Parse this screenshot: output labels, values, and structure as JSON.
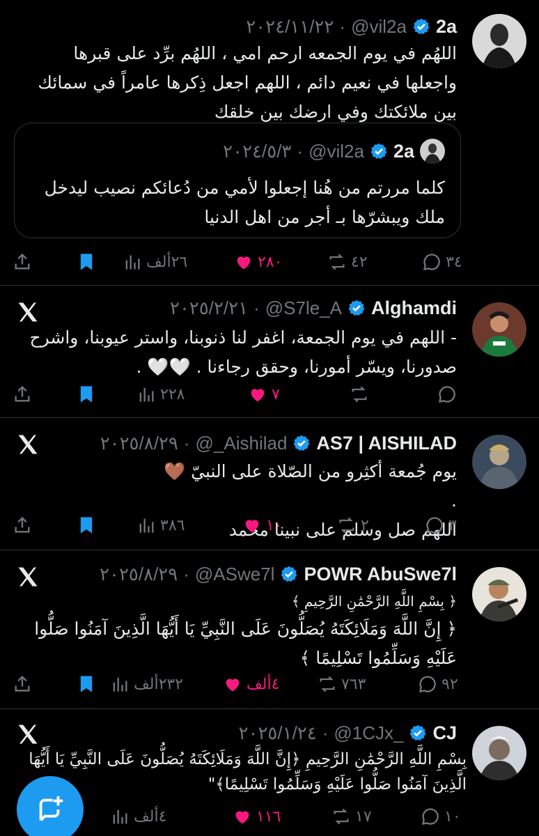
{
  "accent_color": "#1d9bf0",
  "like_color": "#f91880",
  "tweets": [
    {
      "name": "2a",
      "handle": "@vil2a",
      "date": "٢٠٢٤/١١/٢٢",
      "text": "اللهُم في يوم الجمعه ارحم امي ، اللهُم برِّد على قبرها واجعلها في نعيم دائم ، اللهم اجعل ذِكرها عامراً في سمائك بين ملائكتك وفي ارضك بين خلقك",
      "quote": {
        "name": "2a",
        "handle": "@vil2a",
        "date": "٢٠٢٤/٥/٣",
        "text": "كلما مررتم من هُنا إجعلوا لأمي من دُعائكم نصيب ليدخل ملك ويبشرّها بـ أجر من اهل الدنيا"
      },
      "replies": "٣٤",
      "retweets": "٤٢",
      "likes": "٢٨٠",
      "views": "٢٦ألف",
      "liked": true
    },
    {
      "name": "Alghamdi",
      "handle": "@S7le_A",
      "date": "٢٠٢٥/٢/٢١",
      "text": "- اللهم في يوم الجمعة، اغفر لنا ذنوبنا، واستر عيوبنا، واشرح صدورنا، ويسّر أمورنا، وحقق رجاءنا . 🤍🤍 .",
      "replies": "",
      "retweets": "",
      "likes": "٧",
      "views": "٢٢٨",
      "liked": true
    },
    {
      "name": "AS7 | AISHILAD",
      "handle": "@_Aishilad",
      "date": "٢٠٢٥/٨/٢٩",
      "text": "يوم جُمعة أكثِرو من الصّلاة على النبيّ 🤎 .\nاللهم صل وسلم على نبينا محمد",
      "replies": "٣",
      "retweets": "٢",
      "likes": "١٠",
      "views": "٣٨٦",
      "liked": true
    },
    {
      "name": "POWR AbuSwe7l",
      "handle": "@ASwe7l",
      "date": "٢٠٢٥/٨/٢٩",
      "bismillah": "﴿ بِسْمِ اللَّهِ الرَّحْمَٰنِ الرَّحِيمِ ﴾",
      "text": "﴿ إِنَّ اللَّهَ وَمَلَائِكَتَهُ يُصَلُّونَ عَلَى النَّبِيِّ يَا أَيُّهَا الَّذِينَ آمَنُوا صَلُّوا عَلَيْهِ وَسَلِّمُوا تَسْلِيمًا ﴾",
      "replies": "٩٢",
      "retweets": "٧٦٣",
      "likes": "٤ألف",
      "views": "٢٣٢ألف",
      "liked": true
    },
    {
      "name": "CJ",
      "handle": "@1CJx_",
      "date": "٢٠٢٥/١/٢٤",
      "text": "بِسْمِ اللَّهِ الرَّحْمَٰنِ الرَّحِيمِ ﴿إِنَّ اللَّهَ وَمَلَائِكَتَهُ يُصَلُّونَ عَلَى النَّبِيِّ يَا أَيُّهَا الَّذِينَ آمَنُوا صَلُّوا عَلَيْهِ وَسَلِّمُوا تَسْلِيمًا﴾\"",
      "replies": "١٠",
      "retweets": "١٧",
      "likes": "١١٦",
      "views": "٤ألف",
      "liked": true
    }
  ]
}
